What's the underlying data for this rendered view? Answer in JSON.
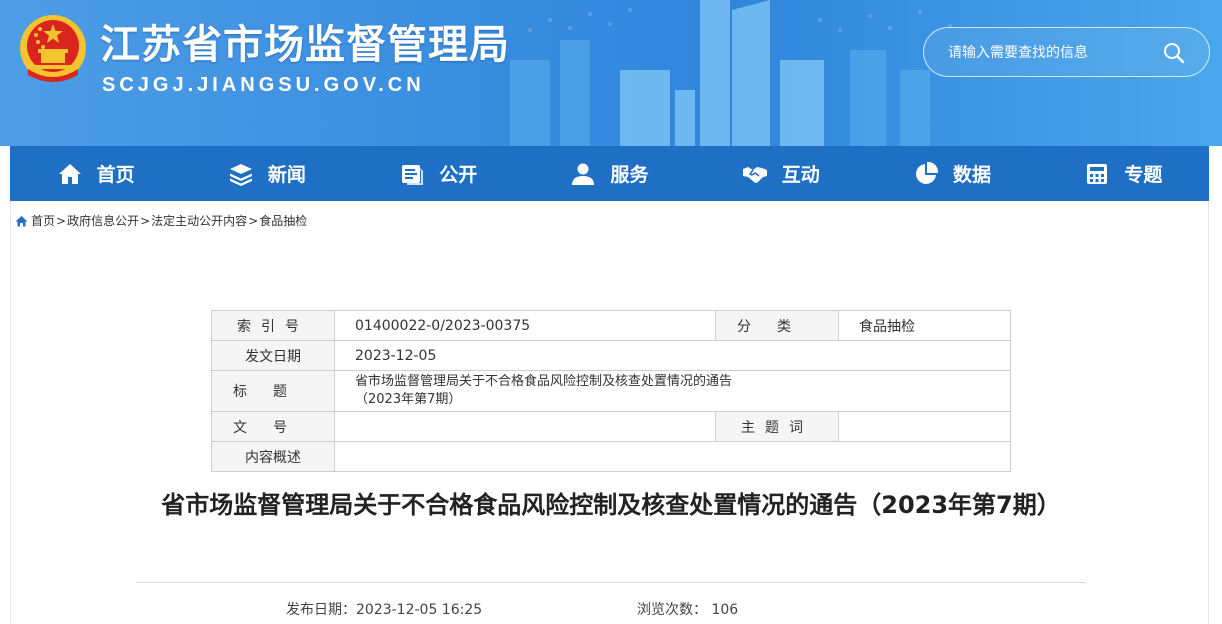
{
  "site": {
    "title": "江苏省市场监督管理局",
    "domain": "SCJGJ.JIANGSU.GOV.CN",
    "search_placeholder": "请输入需要查找的信息"
  },
  "nav": [
    {
      "label": "首页",
      "icon": "home-icon"
    },
    {
      "label": "新闻",
      "icon": "layers-icon"
    },
    {
      "label": "公开",
      "icon": "document-icon"
    },
    {
      "label": "服务",
      "icon": "user-icon"
    },
    {
      "label": "互动",
      "icon": "handshake-icon"
    },
    {
      "label": "数据",
      "icon": "pie-chart-icon"
    },
    {
      "label": "专题",
      "icon": "calculator-icon"
    }
  ],
  "breadcrumb": [
    "首页",
    "政府信息公开",
    "法定主动公开内容",
    "食品抽检"
  ],
  "meta": {
    "index_label": "索引号",
    "index_value": "01400022-0/2023-00375",
    "category_label": "分类",
    "category_value": "食品抽检",
    "date_label": "发文日期",
    "date_value": "2023-12-05",
    "title_label": "标题",
    "title_value_line1": "省市场监督管理局关于不合格食品风险控制及核查处置情况的通告",
    "title_value_line2": "（2023年第7期）",
    "docno_label": "文号",
    "docno_value": "",
    "keywords_label": "主题词",
    "keywords_value": "",
    "summary_label": "内容概述",
    "summary_value": ""
  },
  "article": {
    "title": "省市场监督管理局关于不合格食品风险控制及核查处置情况的通告（2023年第7期）",
    "publish_label": "发布日期：",
    "publish_value": "2023-12-05 16:25",
    "views_label": "浏览次数：",
    "views_value": "106"
  },
  "colors": {
    "header_blue": "#3b8fe0",
    "nav_blue": "#1f6fc4",
    "emblem_red": "#d9251d",
    "emblem_gold": "#f4c430"
  }
}
